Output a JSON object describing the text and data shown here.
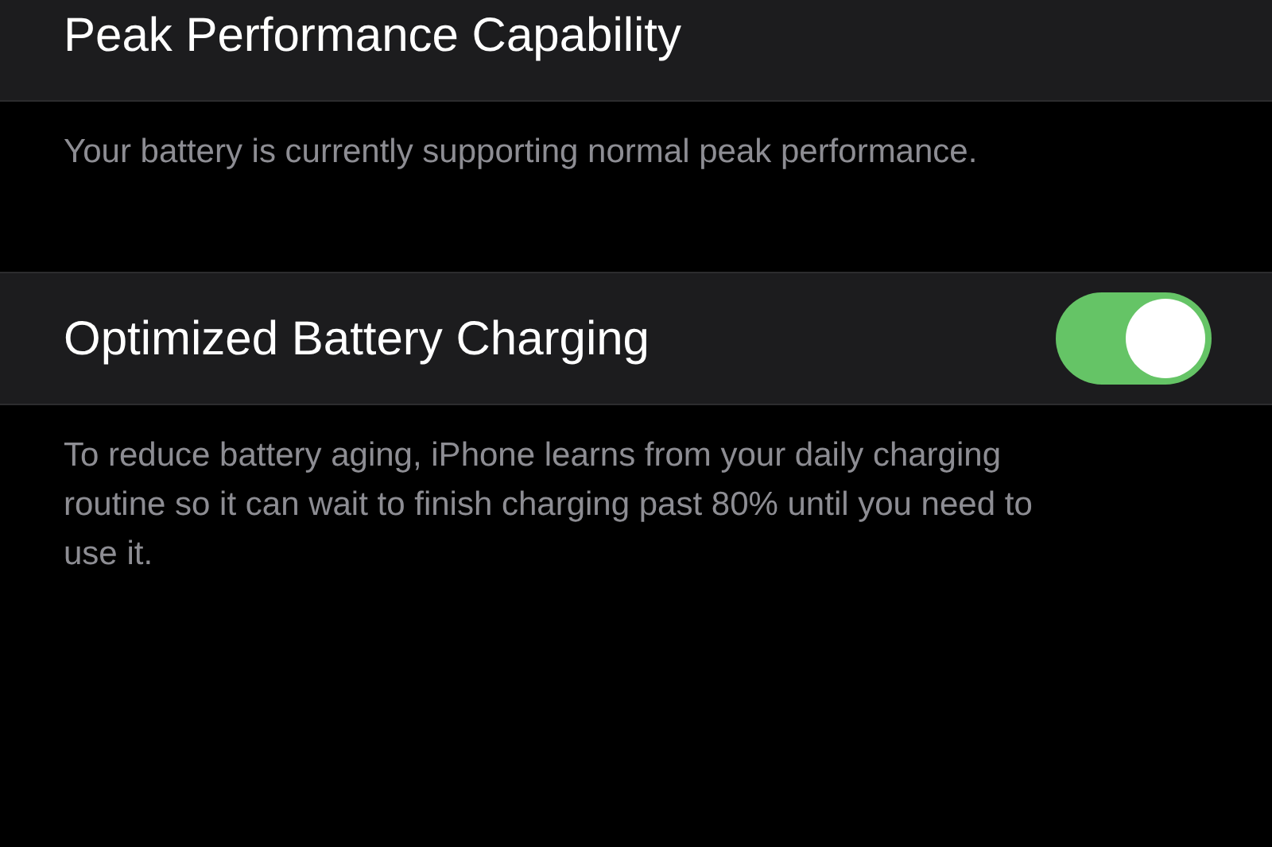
{
  "sections": [
    {
      "title": "Peak Performance Capability",
      "footer": "Your battery is currently supporting normal peak performance."
    },
    {
      "title": "Optimized Battery Charging",
      "toggle": {
        "on": true
      },
      "footer": "To reduce battery aging, iPhone learns from your daily charging routine so it can wait to finish charging past 80% until you need to use it."
    }
  ]
}
